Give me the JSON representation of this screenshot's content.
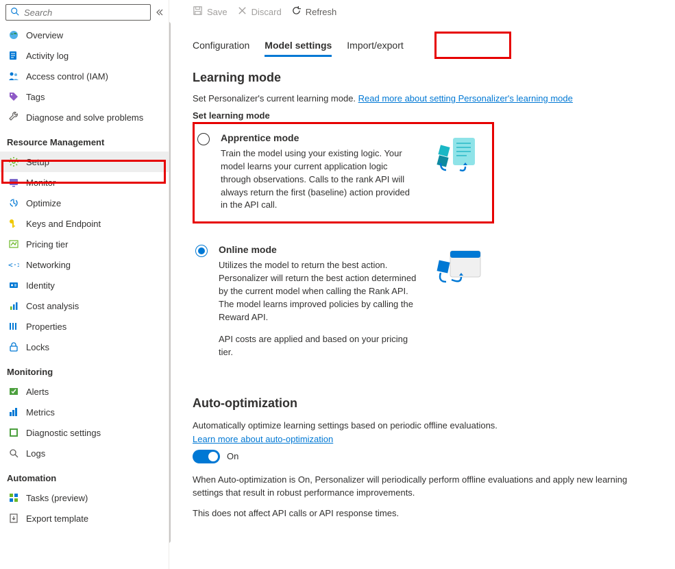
{
  "sidebar": {
    "search_placeholder": "Search",
    "items_top": [
      {
        "label": "Overview"
      },
      {
        "label": "Activity log"
      },
      {
        "label": "Access control (IAM)"
      },
      {
        "label": "Tags"
      },
      {
        "label": "Diagnose and solve problems"
      }
    ],
    "section_resource": "Resource Management",
    "items_resource": [
      {
        "label": "Setup",
        "selected": true
      },
      {
        "label": "Monitor"
      },
      {
        "label": "Optimize"
      },
      {
        "label": "Keys and Endpoint"
      },
      {
        "label": "Pricing tier"
      },
      {
        "label": "Networking"
      },
      {
        "label": "Identity"
      },
      {
        "label": "Cost analysis"
      },
      {
        "label": "Properties"
      },
      {
        "label": "Locks"
      }
    ],
    "section_monitoring": "Monitoring",
    "items_monitoring": [
      {
        "label": "Alerts"
      },
      {
        "label": "Metrics"
      },
      {
        "label": "Diagnostic settings"
      },
      {
        "label": "Logs"
      }
    ],
    "section_automation": "Automation",
    "items_automation": [
      {
        "label": "Tasks (preview)"
      },
      {
        "label": "Export template"
      }
    ]
  },
  "toolbar": {
    "save": "Save",
    "discard": "Discard",
    "refresh": "Refresh"
  },
  "tabs": {
    "configuration": "Configuration",
    "model_settings": "Model settings",
    "import_export": "Import/export"
  },
  "learning": {
    "title": "Learning mode",
    "intro": "Set Personalizer's current learning mode. ",
    "intro_link": "Read more about setting Personalizer's learning mode",
    "subheading": "Set learning mode",
    "apprentice": {
      "title": "Apprentice mode",
      "desc": "Train the model using your existing logic. Your model learns your current application logic through observations. Calls to the rank API will always return the first (baseline) action provided in the API call."
    },
    "online": {
      "title": "Online mode",
      "desc": "Utilizes the model to return the best action. Personalizer will return the best action determined by the current model when calling the Rank API. The model learns improved policies by calling the Reward API.",
      "desc2": "API costs are applied and based on your pricing tier."
    }
  },
  "auto": {
    "title": "Auto-optimization",
    "intro": "Automatically optimize learning settings based on periodic offline evaluations.",
    "link": "Learn more about auto-optimization",
    "toggle_label": "On",
    "para1": "When Auto-optimization is On, Personalizer will periodically perform offline evaluations and apply new learning settings that result in robust performance improvements.",
    "para2": "This does not affect API calls or API response times."
  }
}
